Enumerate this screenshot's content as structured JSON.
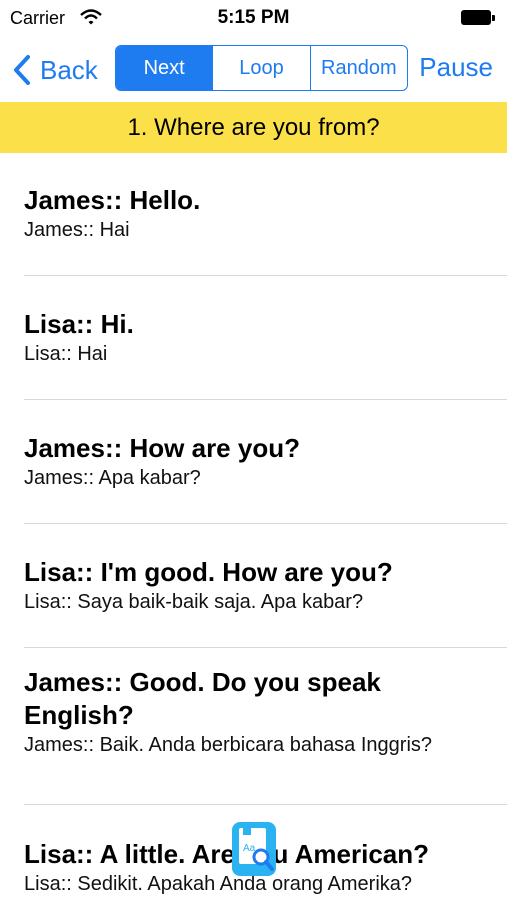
{
  "status_bar": {
    "carrier": "Carrier",
    "time": "5:15 PM"
  },
  "navbar": {
    "back_label": "Back",
    "segments": [
      "Next",
      "Loop",
      "Random"
    ],
    "active_segment": "Next",
    "pause_label": "Pause"
  },
  "title": "1. Where are you from?",
  "dialogue": [
    {
      "en": "James:: Hello.",
      "id": "James:: Hai"
    },
    {
      "en": "Lisa:: Hi.",
      "id": "Lisa:: Hai"
    },
    {
      "en": "James:: How are you?",
      "id": "James:: Apa kabar?"
    },
    {
      "en": "Lisa:: I'm good. How are you?",
      "id": "Lisa:: Saya baik-baik saja. Apa kabar?"
    },
    {
      "en": "James:: Good. Do you speak English?",
      "id": "James:: Baik. Anda berbicara bahasa Inggris?"
    },
    {
      "en": "Lisa:: A little. Are you American?",
      "id": "Lisa:: Sedikit. Apakah Anda orang Amerika?"
    }
  ],
  "colors": {
    "accent": "#1e7cf0",
    "banner": "#fbe04a"
  }
}
